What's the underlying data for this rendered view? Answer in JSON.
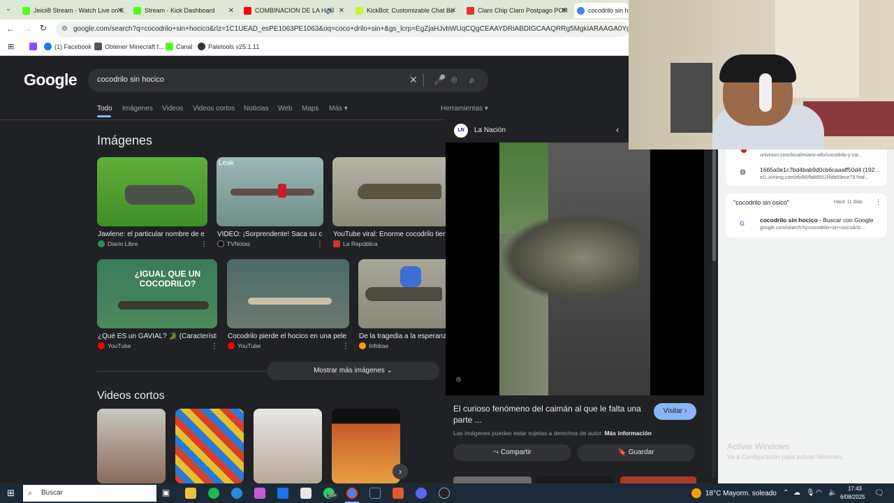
{
  "browser": {
    "tabs": [
      {
        "label": "Jeicii8 Stream - Watch Live on K",
        "color": "#53fc18"
      },
      {
        "label": "Stream - Kick Dashboard",
        "color": "#53fc18"
      },
      {
        "label": "COMBINACION DE LA HAB",
        "color": "#ff0000"
      },
      {
        "label": "KickBot: Customizable Chat Bo",
        "color": "#c6f43a"
      },
      {
        "label": "Claro Chip Claro Postpago POR",
        "color": "#e5322d"
      },
      {
        "label": "cocodrilo sin hoci",
        "color": "#4285f4"
      }
    ],
    "url": "google.com/search?q=cocodrilo+sin+hocico&rlz=1C1UEAD_esPE1063PE1063&oq=coco+drilo+sin+&gs_lcrp=EgZjaHJvbWUqCQgCEAAYDRiABDIGCAAQRRg5MgkIARAAGA0YgAQyCQgCEAAYDRi",
    "bookmarks": [
      "(1) Facebook",
      "Obtener Minecraft f...",
      "Canal",
      "Paletools v25.1.11"
    ]
  },
  "search": {
    "logo": "Google",
    "query": "cocodrilo sin hocico",
    "tabs": [
      "Todo",
      "Imágenes",
      "Videos",
      "Videos cortos",
      "Noticias",
      "Web",
      "Maps",
      "Más"
    ],
    "tools": "Herramientas"
  },
  "images": {
    "heading": "Imágenes",
    "row1": [
      {
        "caption": "Jawlene: el particular nombre de e...",
        "source": "Diario Libre",
        "badge": "",
        "color": "#3f8f2a"
      },
      {
        "caption": "VIDEO: ¡Sorprendente! Saca su c...",
        "source": "TVNotas",
        "badge": "Leak",
        "color": "#7aa0a8"
      },
      {
        "caption": "YouTube viral: Enorme cocodrilo tiene",
        "source": "La República",
        "badge": "",
        "color": "#8a8a7a"
      }
    ],
    "row2": [
      {
        "caption": "¿Qué ES un GAVIAL? 🐊 (Característi...",
        "source": "YouTube",
        "overlay": "¿IGUAL QUE UN COCODRILO?",
        "color": "#4a8a5a"
      },
      {
        "caption": "Cocodrilo pierde el hocico en una pele...",
        "source": "YouTube",
        "overlay": "",
        "color": "#6a7a70"
      },
      {
        "caption": "De la tragedia a la esperanza:",
        "source": "Infobae",
        "overlay": "",
        "color": "#8a8878"
      }
    ],
    "more_label": "Mostrar más imágenes"
  },
  "shorts": {
    "heading": "Videos cortos"
  },
  "panel": {
    "source": "La Nación",
    "title": "El curioso fenómeno del caimán al que le falta una parte ...",
    "visit": "Visitar",
    "notice": "Las imágenes pueden estar sujetas a derechos de autor.",
    "more_info": "Más información",
    "share": "Compartir",
    "save": "Guardar"
  },
  "history": {
    "entry1_title": "1665a0e1c7bd4bab9d0cb6caaaff50d4 (192...",
    "entry1_url": "st1.uvnimg.com/eb/80/fa66551f4db69ece797eaf...",
    "entry0_url": "univision.com/local/miami-wltv/cocodrilo-y-cai...",
    "group_title": "\"cocodrilo sin osico\"",
    "group_time": "Hace 11 días",
    "entry2_title_bold": "cocodrilo sin hocico",
    "entry2_title_rest": " - Buscar con Google",
    "entry2_url": "google.com/search?q=cocodrilo+sin+osico&rlz...",
    "activate1": "Activar Windows",
    "activate2": "Ve a Configuración para activar Windows."
  },
  "taskbar": {
    "search": "Buscar",
    "weather": "18°C  Mayorm. soleado",
    "time": "17:43",
    "date": "6/08/2025",
    "badge": "99+"
  }
}
